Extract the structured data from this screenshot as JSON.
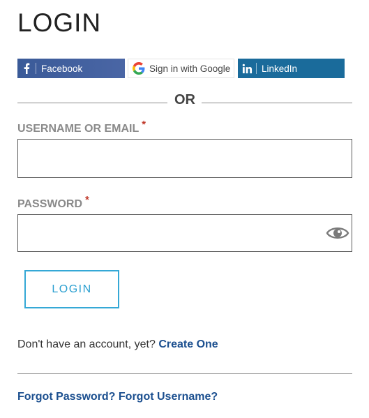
{
  "page": {
    "title": "LOGIN"
  },
  "social": {
    "facebook_label": "Facebook",
    "google_label": "Sign in with Google",
    "linkedin_label": "LinkedIn",
    "facebook_color": "#3b5998",
    "linkedin_color": "#1a6b9b"
  },
  "divider": {
    "or_text": "OR"
  },
  "form": {
    "username_label": "USERNAME OR EMAIL",
    "password_label": "PASSWORD",
    "required_marker": "*",
    "username_value": "",
    "password_value": "",
    "submit_label": "LOGIN",
    "accent_color": "#35a8d6"
  },
  "footer": {
    "no_account_text": "Don't have an account, yet?",
    "create_link": "Create One",
    "forgot_password_link": "Forgot Password?",
    "forgot_username_link": "Forgot Username?",
    "link_color": "#1b4f8f"
  },
  "icons": [
    "facebook-icon",
    "google-icon",
    "linkedin-icon",
    "eye-icon"
  ]
}
